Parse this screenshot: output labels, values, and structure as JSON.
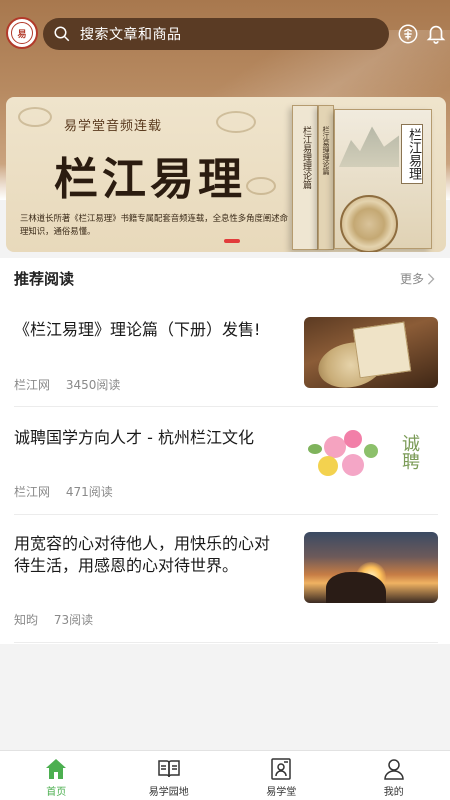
{
  "header": {
    "logo_text": "易",
    "search_placeholder": "搜索文章和商品"
  },
  "banner": {
    "kicker": "易学堂音频连载",
    "title": "栏江易理",
    "description": "三林道长所著《栏江易理》书籍专属配套音频连载，全息性多角度阐述命理知识，通俗易懂。",
    "book_title": "栏江易理",
    "book_spine_1": "栏江易理理论篇",
    "book_spine_2": "栏江易理理论篇"
  },
  "section": {
    "title": "推荐阅读",
    "more": "更多"
  },
  "articles": [
    {
      "title": "《栏江易理》理论篇（下册）发售!",
      "source": "栏江网",
      "reads": "3450阅读"
    },
    {
      "title": "诚聘国学方向人才 - 杭州栏江文化",
      "source": "栏江网",
      "reads": "471阅读",
      "thumb_text": "诚聘"
    },
    {
      "title": "用宽容的心对待他人，用快乐的心对待生活，用感恩的心对待世界。",
      "source": "知昀",
      "reads": "73阅读"
    }
  ],
  "tabs": [
    {
      "label": "首页",
      "icon": "home-icon",
      "active": true
    },
    {
      "label": "易学园地",
      "icon": "book-icon",
      "active": false
    },
    {
      "label": "易学堂",
      "icon": "classroom-icon",
      "active": false
    },
    {
      "label": "我的",
      "icon": "user-icon",
      "active": false
    }
  ],
  "colors": {
    "accent": "#4caf50",
    "search_bg": "#5a3b24",
    "banner_indicator": "#e23c3c"
  }
}
